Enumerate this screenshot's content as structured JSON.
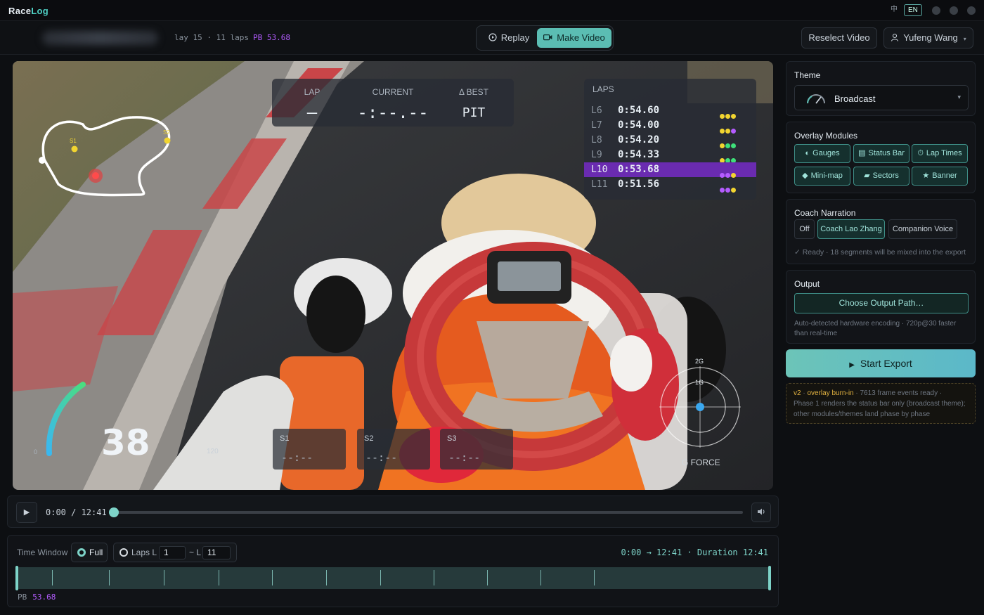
{
  "app": {
    "brand_a": "Race",
    "brand_b": "Log"
  },
  "titlebar": {
    "lang_zh": "中",
    "lang_en": "EN"
  },
  "header": {
    "session_meta": "lay 15 · 11 laps",
    "pb_label": "PB 53.68",
    "mode_replay": "Replay",
    "mode_make_video": "Make Video",
    "reselect_video": "Reselect Video",
    "user_name": "Yufeng Wang"
  },
  "overlay": {
    "lap_header": "LAP",
    "lap_value": "—",
    "current_header": "CURRENT",
    "current_value": "-:--.--",
    "best_header": "Δ BEST",
    "best_value": "PIT",
    "laps_title": "LAPS",
    "laps": [
      {
        "lap": "L6",
        "time": "0:54.60",
        "dots": [
          "#f2d530",
          "#f2d530",
          "#f2d530"
        ]
      },
      {
        "lap": "L7",
        "time": "0:54.00",
        "dots": [
          "#f2d530",
          "#f2d530",
          "#b45cff"
        ]
      },
      {
        "lap": "L8",
        "time": "0:54.20",
        "dots": [
          "#f2d530",
          "#3ee07a",
          "#3ee07a"
        ]
      },
      {
        "lap": "L9",
        "time": "0:54.33",
        "dots": [
          "#f2d530",
          "#3ee07a",
          "#3ee07a"
        ]
      },
      {
        "lap": "L10",
        "time": "0:53.68",
        "dots": [
          "#b45cff",
          "#b45cff",
          "#f2d530"
        ],
        "best": true
      },
      {
        "lap": "L11",
        "time": "0:51.56",
        "dots": [
          "#b45cff",
          "#b45cff",
          "#f2d530"
        ]
      }
    ],
    "sectors": [
      {
        "name": "S1",
        "time": "--:--"
      },
      {
        "name": "S2",
        "time": "--:--"
      },
      {
        "name": "S3",
        "time": "--:--"
      }
    ],
    "minimap": {
      "s1": "S1",
      "s2": "S2"
    },
    "speed_value": "38",
    "speed_scale_max": "120",
    "speed_scale_min": "0",
    "gforce_label": "G FORCE",
    "g2_label": "2G",
    "g1_label": "1G"
  },
  "player": {
    "play_icon": "▶",
    "time_display": "0:00 / 12:41",
    "progress": 0.0,
    "volume_icon": "🔈"
  },
  "timeline": {
    "label": "Time Window",
    "full_label": "Full",
    "laps_label": "Laps L",
    "lap_from": "1",
    "tilde_label": "~ L",
    "lap_to": "11",
    "range_text": "0:00 → 12:41 · Duration 12:41",
    "pb_label": "PB",
    "pb_value": "53.68"
  },
  "sidebar": {
    "theme_title": "Theme",
    "theme_value": "Broadcast",
    "modules_title": "Overlay Modules",
    "modules": [
      {
        "icon": "◐",
        "label": "Gauges"
      },
      {
        "icon": "▤",
        "label": "Status Bar"
      },
      {
        "icon": "⏱",
        "label": "Lap Times"
      },
      {
        "icon": "◆",
        "label": "Mini-map"
      },
      {
        "icon": "▰",
        "label": "Sectors"
      },
      {
        "icon": "★",
        "label": "Banner"
      }
    ],
    "coach_title": "Coach Narration",
    "coach_options": [
      "Off",
      "Coach Lao Zhang",
      "Companion Voice"
    ],
    "coach_status": "✓ Ready · 18 segments will be mixed into the export",
    "output_title": "Output",
    "output_button": "Choose Output Path…",
    "output_note_1": "Auto-detected hardware encoding · 720p@30 faster",
    "output_note_2": "than real-time",
    "export_label": "Start Export",
    "info_version": "v2",
    "info_title": "overlay burn-in",
    "info_frames": "7613 frame events ready",
    "info_line2": "Phase 1 renders the status bar only (broadcast theme);",
    "info_line3": "other modules/themes land phase by phase"
  },
  "colors": {
    "accent": "#5bbdb3",
    "pb_purple": "#b35cff",
    "warning": "#e3b341"
  }
}
